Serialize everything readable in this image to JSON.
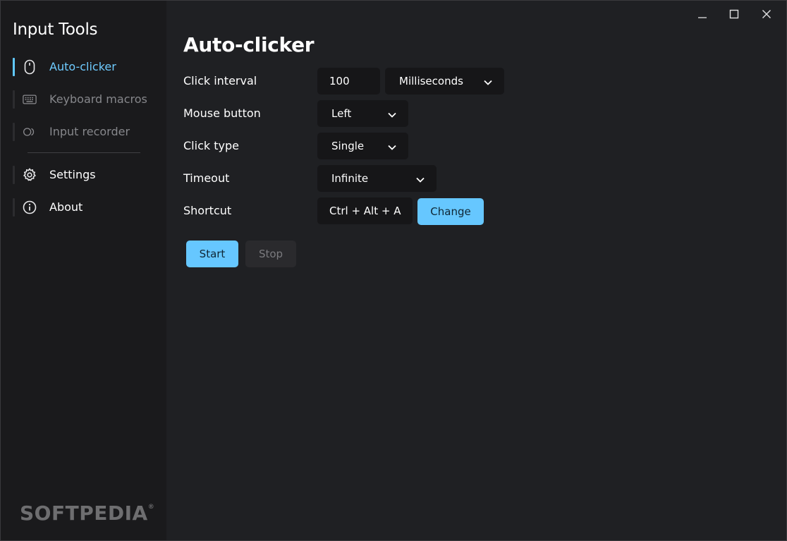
{
  "app": {
    "title": "Input Tools",
    "watermark": "SOFTPEDIA",
    "watermark_mark": "®"
  },
  "colors": {
    "accent": "#66c7ff",
    "sidebar": "#1a1a1c",
    "content": "#1f2023",
    "field": "#161618"
  },
  "sidebar": {
    "items": [
      {
        "label": "Auto-clicker",
        "icon": "mouse-icon",
        "state": "active"
      },
      {
        "label": "Keyboard macros",
        "icon": "keyboard-icon",
        "state": "disabled"
      },
      {
        "label": "Input recorder",
        "icon": "record-icon",
        "state": "disabled"
      },
      {
        "label": "Settings",
        "icon": "gear-icon",
        "state": "normal"
      },
      {
        "label": "About",
        "icon": "info-icon",
        "state": "normal"
      }
    ]
  },
  "window_controls": [
    "minimize-icon",
    "maximize-icon",
    "close-icon"
  ],
  "main": {
    "title": "Auto-clicker",
    "rows": {
      "click_interval": {
        "label": "Click interval",
        "value": "100",
        "unit": "Milliseconds"
      },
      "mouse_button": {
        "label": "Mouse button",
        "value": "Left"
      },
      "click_type": {
        "label": "Click type",
        "value": "Single"
      },
      "timeout": {
        "label": "Timeout",
        "value": "Infinite"
      },
      "shortcut": {
        "label": "Shortcut",
        "value": "Ctrl + Alt + A",
        "change_label": "Change"
      }
    },
    "start_label": "Start",
    "stop_label": "Stop"
  }
}
